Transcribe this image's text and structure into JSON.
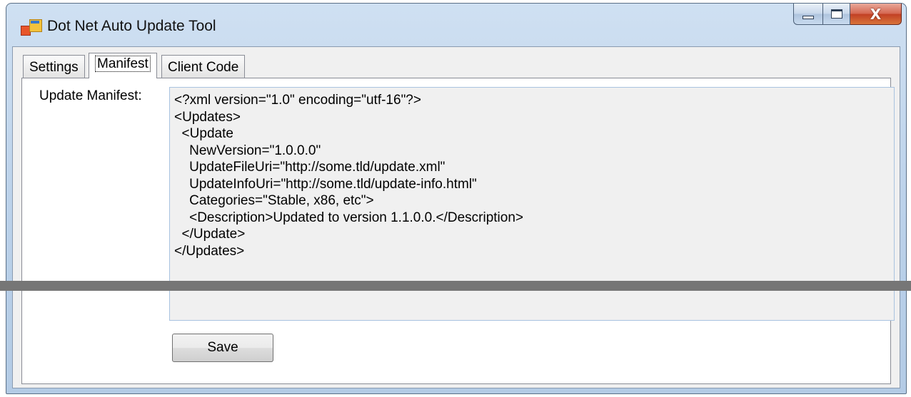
{
  "window": {
    "title": "Dot Net Auto Update Tool",
    "icon": "app-window-icon",
    "caption_buttons": {
      "minimize": "minimize-icon",
      "maximize": "maximize-icon",
      "close": "X"
    }
  },
  "tabs": [
    {
      "label": "Settings",
      "active": false
    },
    {
      "label": "Manifest",
      "active": true
    },
    {
      "label": "Client Code",
      "active": false
    }
  ],
  "manifest": {
    "label": "Update Manifest:",
    "lines": [
      "<?xml version=\"1.0\" encoding=\"utf-16\"?>",
      "<Updates>",
      "  <Update",
      "    NewVersion=\"1.0.0.0\"",
      "    UpdateFileUri=\"http://some.tld/update.xml\"",
      "    UpdateInfoUri=\"http://some.tld/update-info.html\"",
      "    Categories=\"Stable, x86, etc\">",
      "    <Description>Updated to version 1.1.0.0.</Description>",
      "  </Update>",
      "</Updates>"
    ]
  },
  "save_button": {
    "label": "Save"
  },
  "colors": {
    "window_frame": "#bcd2ea",
    "close_button": "#c13f24",
    "textarea_bg": "#f0f0f0",
    "overlay_bar": "#767676"
  }
}
